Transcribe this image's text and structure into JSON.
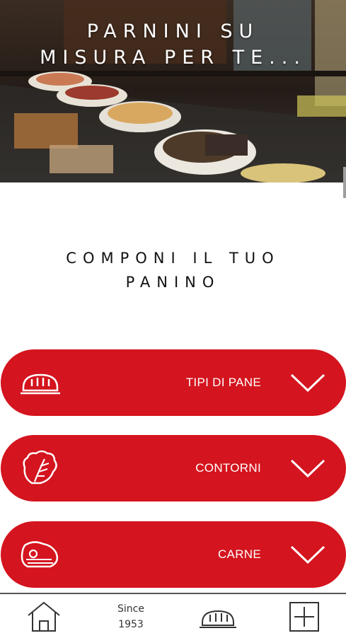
{
  "hero": {
    "title_line1": "PARNINI SU",
    "title_line2": "MISURA PER TE..."
  },
  "section": {
    "title_line1": "COMPONI IL TUO",
    "title_line2": "PANINO"
  },
  "categories": [
    {
      "label": "TIPI DI PANE",
      "icon": "bread-icon"
    },
    {
      "label": "CONTORNI",
      "icon": "lettuce-icon"
    },
    {
      "label": "CARNE",
      "icon": "steak-icon"
    }
  ],
  "bottom_nav": {
    "since_label": "Since",
    "since_year": "1953",
    "items": [
      "home-icon",
      "since-1953",
      "bread-icon",
      "plus-icon"
    ]
  },
  "colors": {
    "accent": "#d4141e",
    "text": "#111111"
  }
}
